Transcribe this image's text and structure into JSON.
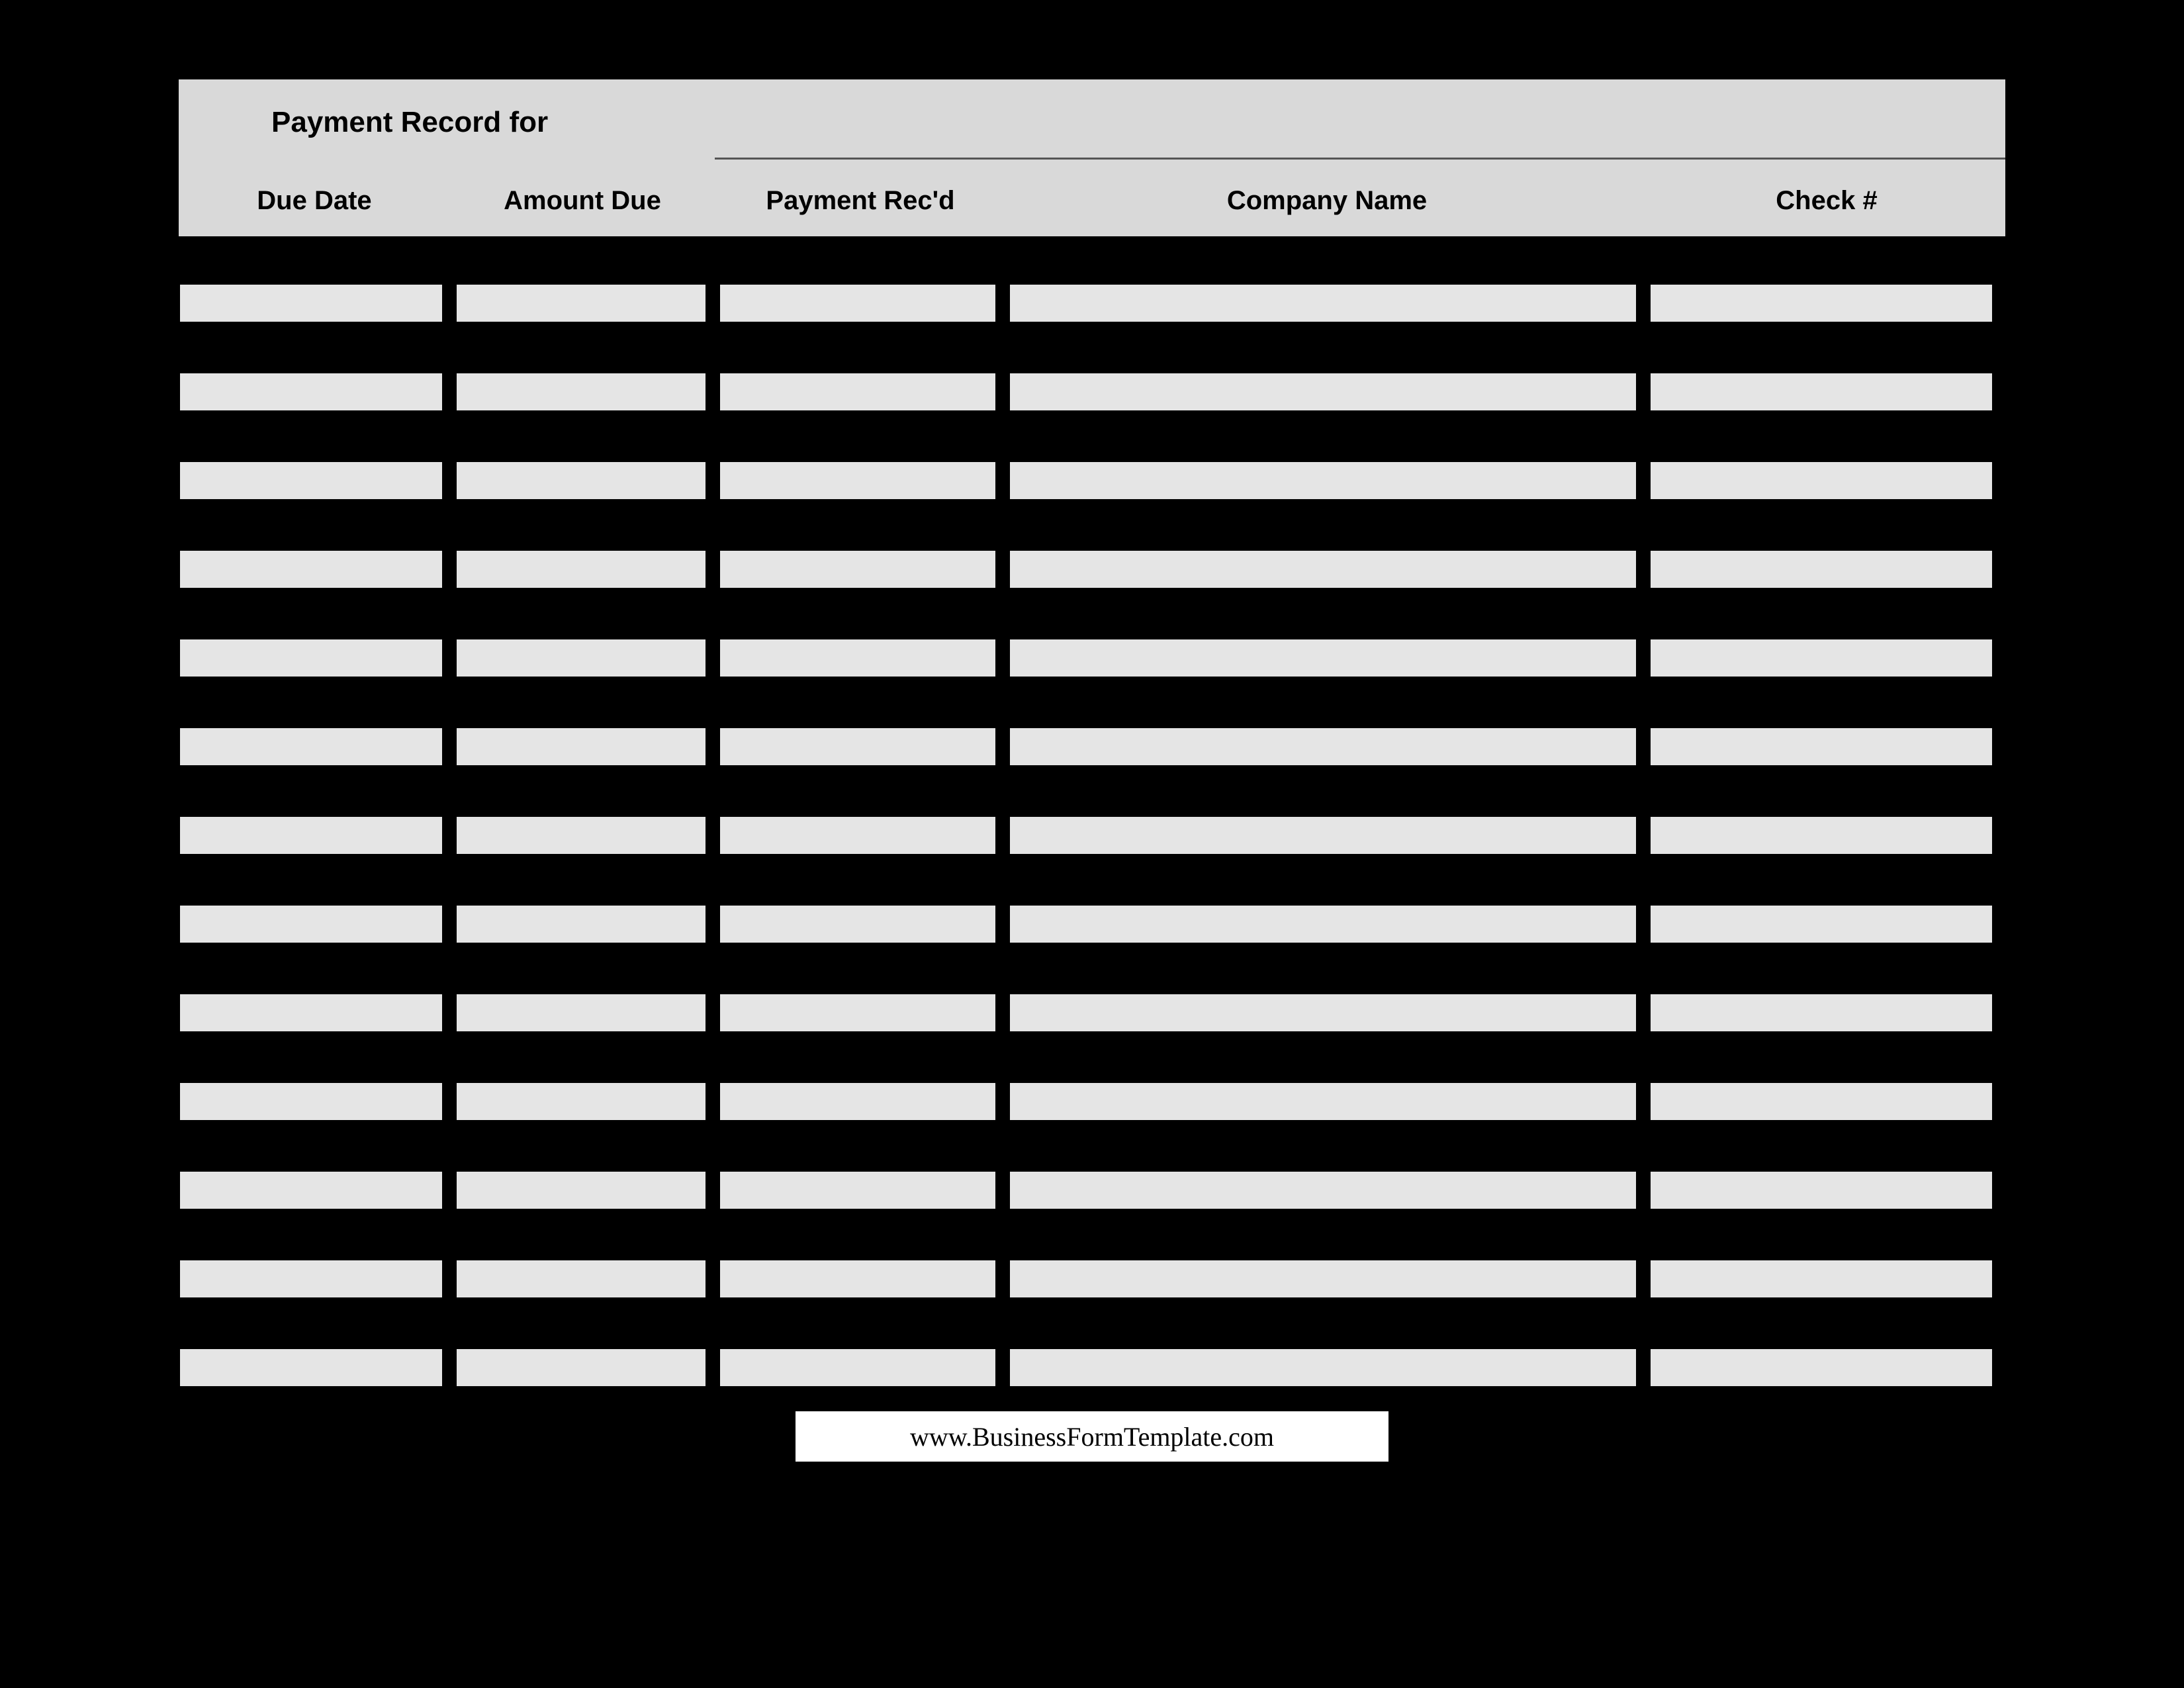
{
  "header": {
    "title": "Payment Record for",
    "record_for": ""
  },
  "columns": {
    "due_date": "Due Date",
    "amount_due": "Amount Due",
    "payment_recd": "Payment Rec'd",
    "company_name": "Company Name",
    "check_num": "Check #"
  },
  "rows": [
    {
      "due_date": "",
      "amount_due": "",
      "payment_recd": "",
      "company_name": "",
      "check_num": ""
    },
    {
      "due_date": "",
      "amount_due": "",
      "payment_recd": "",
      "company_name": "",
      "check_num": ""
    },
    {
      "due_date": "",
      "amount_due": "",
      "payment_recd": "",
      "company_name": "",
      "check_num": ""
    },
    {
      "due_date": "",
      "amount_due": "",
      "payment_recd": "",
      "company_name": "",
      "check_num": ""
    },
    {
      "due_date": "",
      "amount_due": "",
      "payment_recd": "",
      "company_name": "",
      "check_num": ""
    },
    {
      "due_date": "",
      "amount_due": "",
      "payment_recd": "",
      "company_name": "",
      "check_num": ""
    },
    {
      "due_date": "",
      "amount_due": "",
      "payment_recd": "",
      "company_name": "",
      "check_num": ""
    },
    {
      "due_date": "",
      "amount_due": "",
      "payment_recd": "",
      "company_name": "",
      "check_num": ""
    },
    {
      "due_date": "",
      "amount_due": "",
      "payment_recd": "",
      "company_name": "",
      "check_num": ""
    },
    {
      "due_date": "",
      "amount_due": "",
      "payment_recd": "",
      "company_name": "",
      "check_num": ""
    },
    {
      "due_date": "",
      "amount_due": "",
      "payment_recd": "",
      "company_name": "",
      "check_num": ""
    },
    {
      "due_date": "",
      "amount_due": "",
      "payment_recd": "",
      "company_name": "",
      "check_num": ""
    },
    {
      "due_date": "",
      "amount_due": "",
      "payment_recd": "",
      "company_name": "",
      "check_num": ""
    }
  ],
  "footer": {
    "url_text": "www.BusinessFormTemplate.com"
  }
}
